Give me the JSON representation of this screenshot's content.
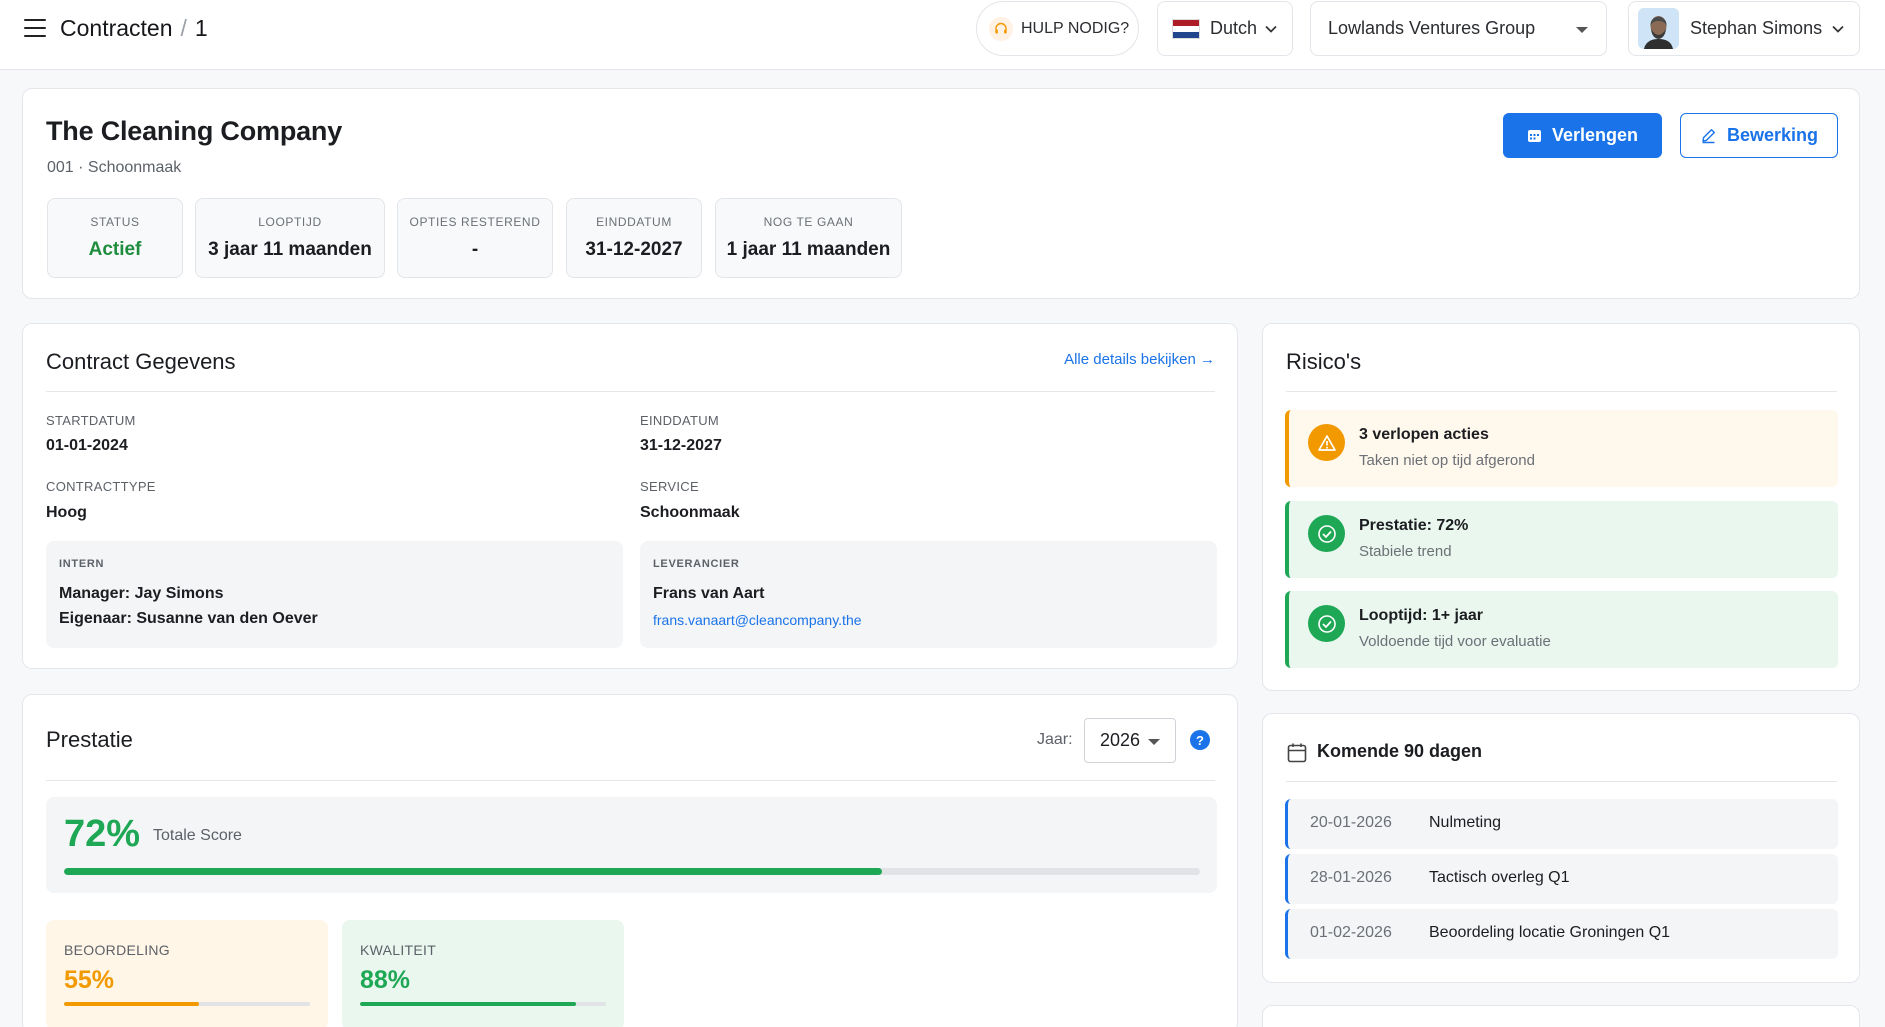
{
  "header": {
    "breadcrumb_section": "Contracten",
    "breadcrumb_sep": "/",
    "breadcrumb_id": "1",
    "help_label": "HULP NODIG?",
    "language": "Dutch",
    "organization": "Lowlands Ventures Group",
    "user_name": "Stephan Simons"
  },
  "contract": {
    "title": "The Cleaning Company",
    "subtitle": "001 · Schoonmaak",
    "extend_label": "Verlengen",
    "edit_label": "Bewerking",
    "stats": [
      {
        "label": "STATUS",
        "value": "Actief"
      },
      {
        "label": "LOOPTIJD",
        "value": "3 jaar 11 maanden"
      },
      {
        "label": "OPTIES RESTEREND",
        "value": "-"
      },
      {
        "label": "EINDDATUM",
        "value": "31-12-2027"
      },
      {
        "label": "NOG TE GAAN",
        "value": "1 jaar 11 maanden"
      }
    ],
    "colors": {
      "accent": "#1a73e8",
      "status_active": "#1e8e3e"
    }
  },
  "gegevens": {
    "title": "Contract Gegevens",
    "link_all": "Alle details bekijken →",
    "start_label": "STARTDATUM",
    "start_value": "01-01-2024",
    "end_label": "EINDDATUM",
    "end_value": "31-12-2027",
    "type_label": "CONTRACTTYPE",
    "type_value": "Hoog",
    "service_label": "SERVICE",
    "service_value": "Schoonmaak",
    "intern": {
      "label": "INTERN",
      "manager": "Manager: Jay Simons",
      "owner": "Eigenaar: Susanne van den Oever"
    },
    "supplier": {
      "label": "LEVERANCIER",
      "name": "Frans van Aart",
      "email": "frans.vanaart@cleancompany.the"
    }
  },
  "risks": {
    "title": "Risico's",
    "items": [
      {
        "title": "3 verlopen acties",
        "subtitle": "Taken niet op tijd afgerond",
        "kind": "warning",
        "icon": "warning-icon"
      },
      {
        "title": "Prestatie: 72%",
        "subtitle": "Stabiele trend",
        "kind": "ok",
        "icon": "check-circle-icon"
      },
      {
        "title": "Looptijd: 1+ jaar",
        "subtitle": "Voldoende tijd voor evaluatie",
        "kind": "ok",
        "icon": "check-circle-icon"
      }
    ]
  },
  "upcoming": {
    "title": "Komende 90 dagen",
    "events": [
      {
        "date": "20-01-2026",
        "title": "Nulmeting"
      },
      {
        "date": "28-01-2026",
        "title": "Tactisch overleg Q1"
      },
      {
        "date": "01-02-2026",
        "title": "Beoordeling locatie Groningen Q1"
      }
    ]
  },
  "performance": {
    "title": "Prestatie",
    "year_label": "Jaar:",
    "year_value": "2026",
    "help_glyph": "?",
    "total_pct_text": "72%",
    "total_pct": 72,
    "total_label": "Totale Score",
    "beoordeling_label": "BEOORDELING",
    "beoordeling_text": "55%",
    "beoordeling_pct": 55,
    "kwaliteit_label": "KWALITEIT",
    "kwaliteit_text": "88%",
    "kwaliteit_pct": 88,
    "colors": {
      "green": "#1ea754",
      "orange": "#f29900"
    }
  }
}
